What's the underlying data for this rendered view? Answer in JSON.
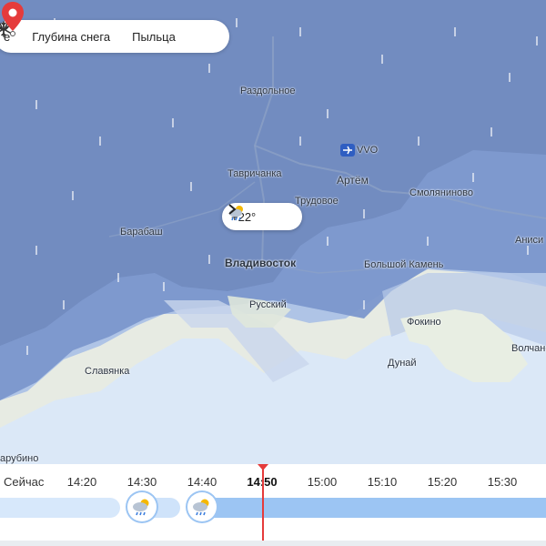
{
  "layers": {
    "partial_label": "е",
    "snow_label": "Глубина снега",
    "pollen_label": "Пыльца"
  },
  "weather_bubble": {
    "temp": "+22°",
    "icon": "rain-cloud-sun-icon"
  },
  "places": {
    "razdolnoe": "Раздольное",
    "vvo": "VVO",
    "artem": "Артём",
    "tavrichanka": "Тавричанка",
    "trudovoe": "Трудовое",
    "smolyaninovo": "Смоляниново",
    "barabash": "Барабаш",
    "vladivostok": "Владивосток",
    "bolshoy_kamen": "Большой Камень",
    "anisimovka": "Аниси",
    "russkiy": "Русский",
    "fokino": "Фокино",
    "slavyanka": "Славянка",
    "volchanets": "Волчане",
    "dunai": "Дунай",
    "zarubino": "арубино"
  },
  "timeline": {
    "now_label": "Сейчас",
    "ticks": [
      "14:20",
      "14:30",
      "14:40",
      "14:50",
      "15:00",
      "15:10",
      "15:20",
      "15:30"
    ],
    "current": "14:50"
  },
  "colors": {
    "precip_heavy": "#7b97cc",
    "precip_light": "#a9c0e6",
    "sea": "#dbe8f7",
    "cursor": "#e53b3b"
  }
}
